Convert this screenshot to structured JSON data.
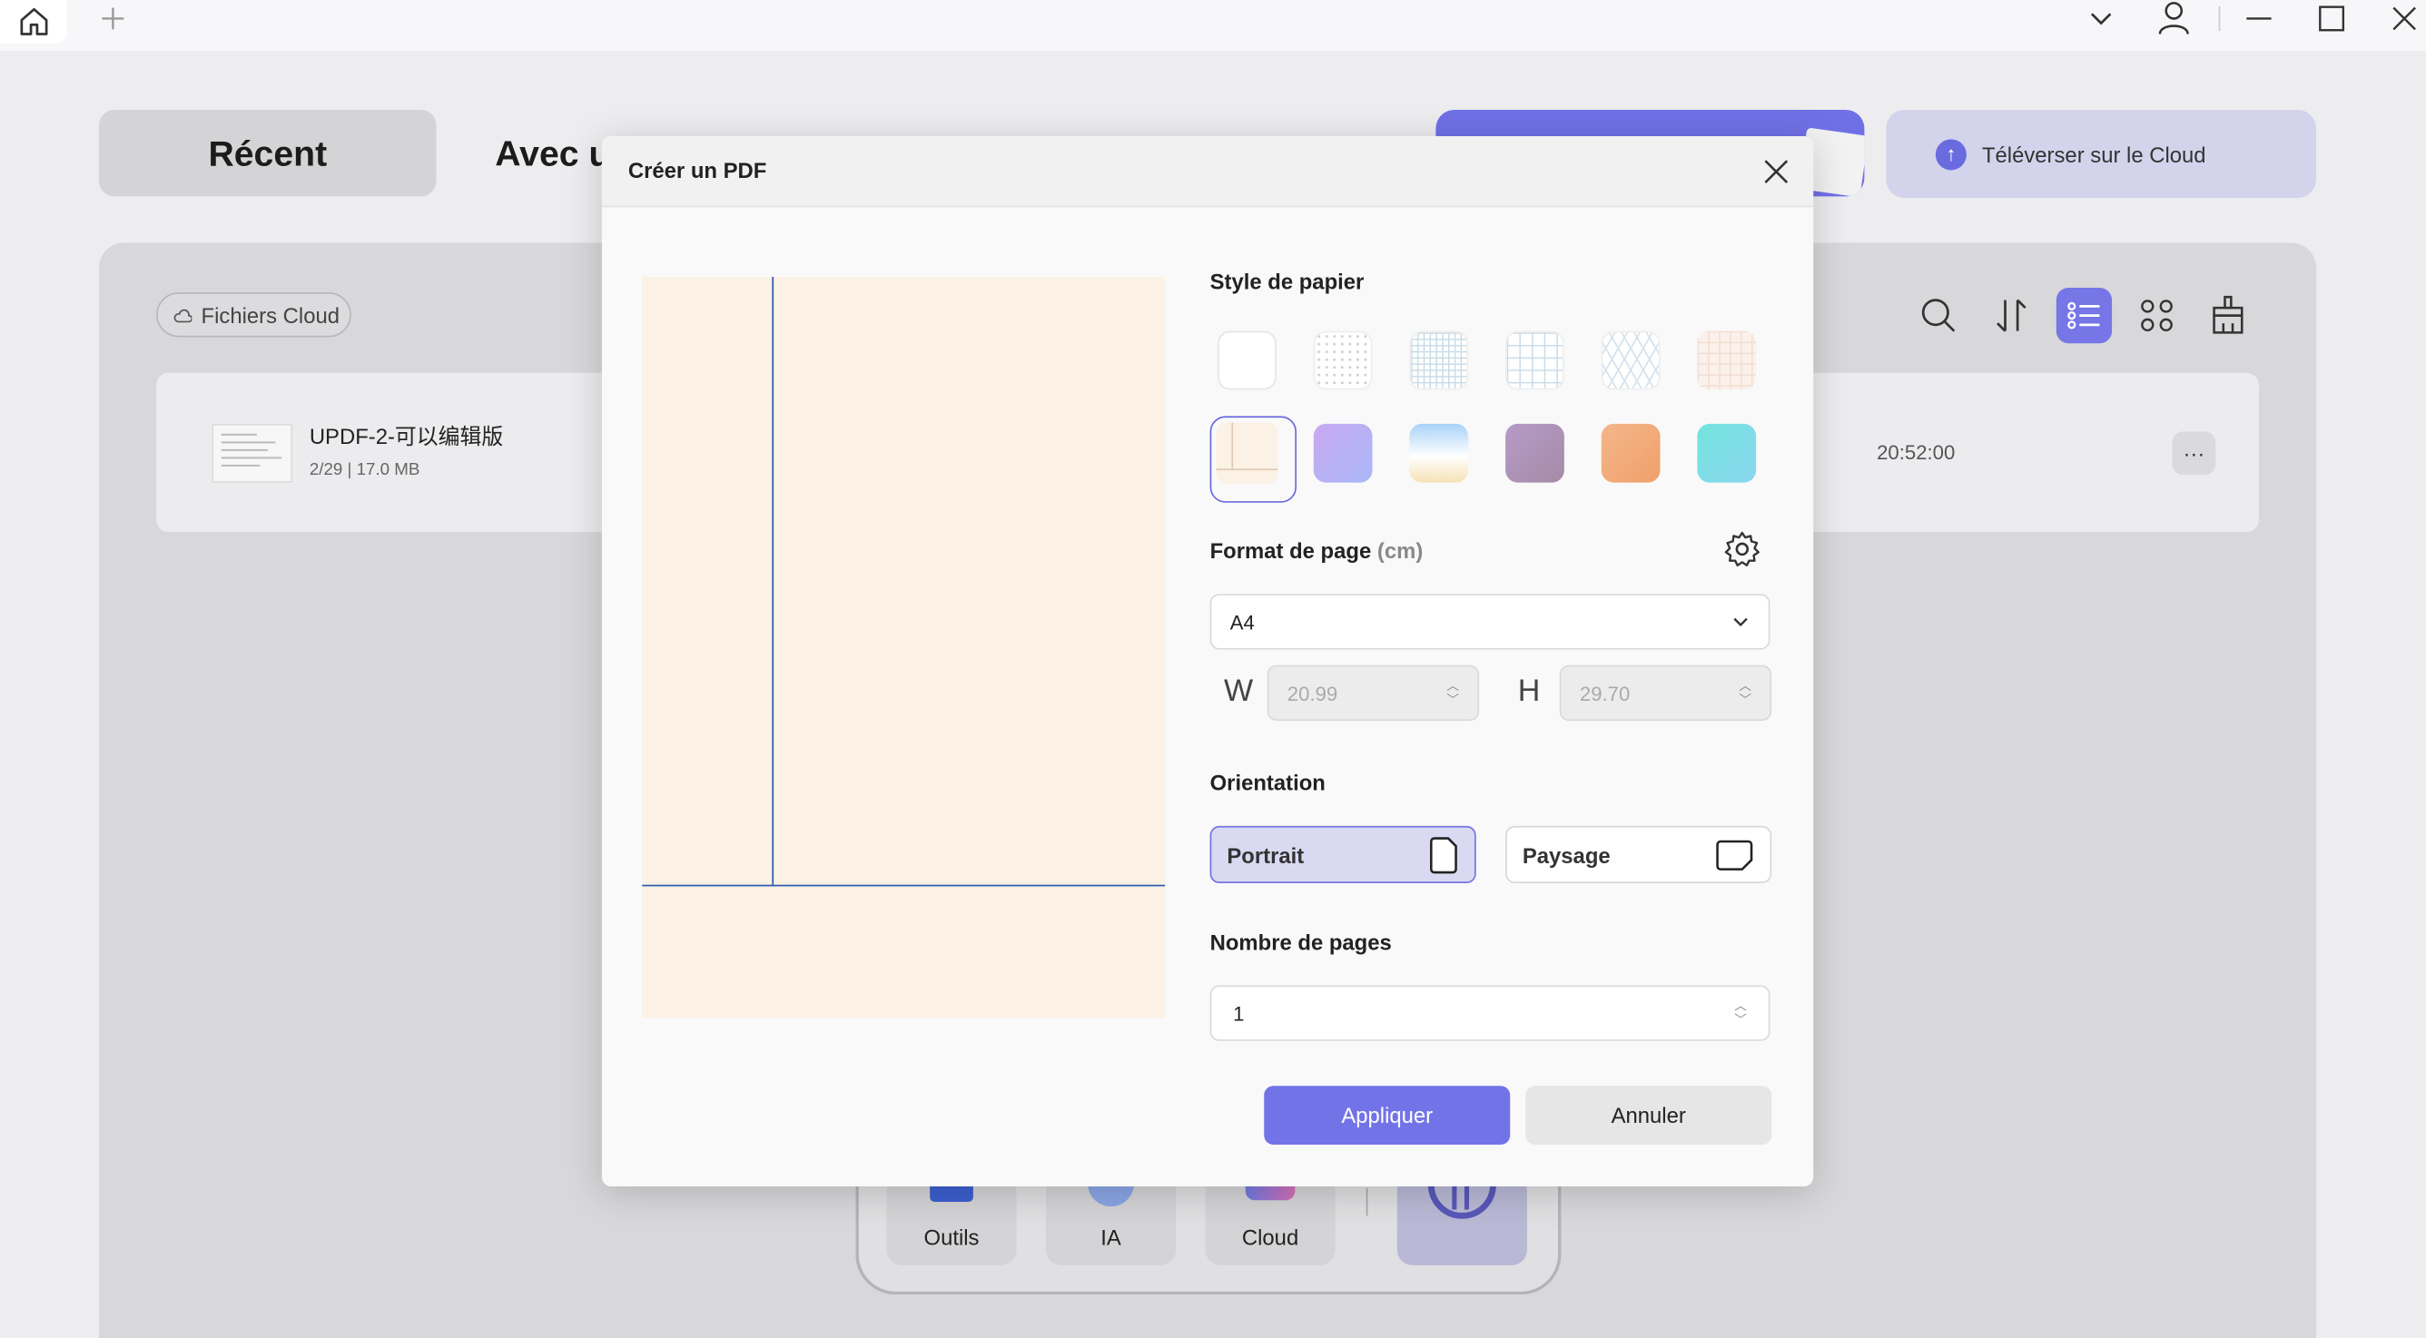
{
  "colors": {
    "accent": "#7373e8",
    "preview_line": "#2e5bb0",
    "preview_paper": "#fbf1e5"
  },
  "main": {
    "tab_recent": "Récent",
    "tab_avec": "Avec u",
    "upload_label": "Téléverser sur le Cloud",
    "cloud_chip": "Fichiers Cloud",
    "file": {
      "name": "UPDF-2-可以编辑版",
      "meta": "2/29 | 17.0 MB",
      "time": "20:52:00",
      "more": "···"
    }
  },
  "dock": {
    "items": [
      "Outils",
      "IA",
      "Cloud"
    ]
  },
  "dialog": {
    "title": "Créer un PDF",
    "paper_style_label": "Style de papier",
    "page_format_label": "Format de page",
    "page_format_unit": "(cm)",
    "format_value": "A4",
    "width_label": "W",
    "width_value": "20.99",
    "height_label": "H",
    "height_value": "29.70",
    "orientation_label": "Orientation",
    "portrait_label": "Portrait",
    "landscape_label": "Paysage",
    "page_count_label": "Nombre de pages",
    "page_count_value": "1",
    "apply_label": "Appliquer",
    "cancel_label": "Annuler"
  }
}
